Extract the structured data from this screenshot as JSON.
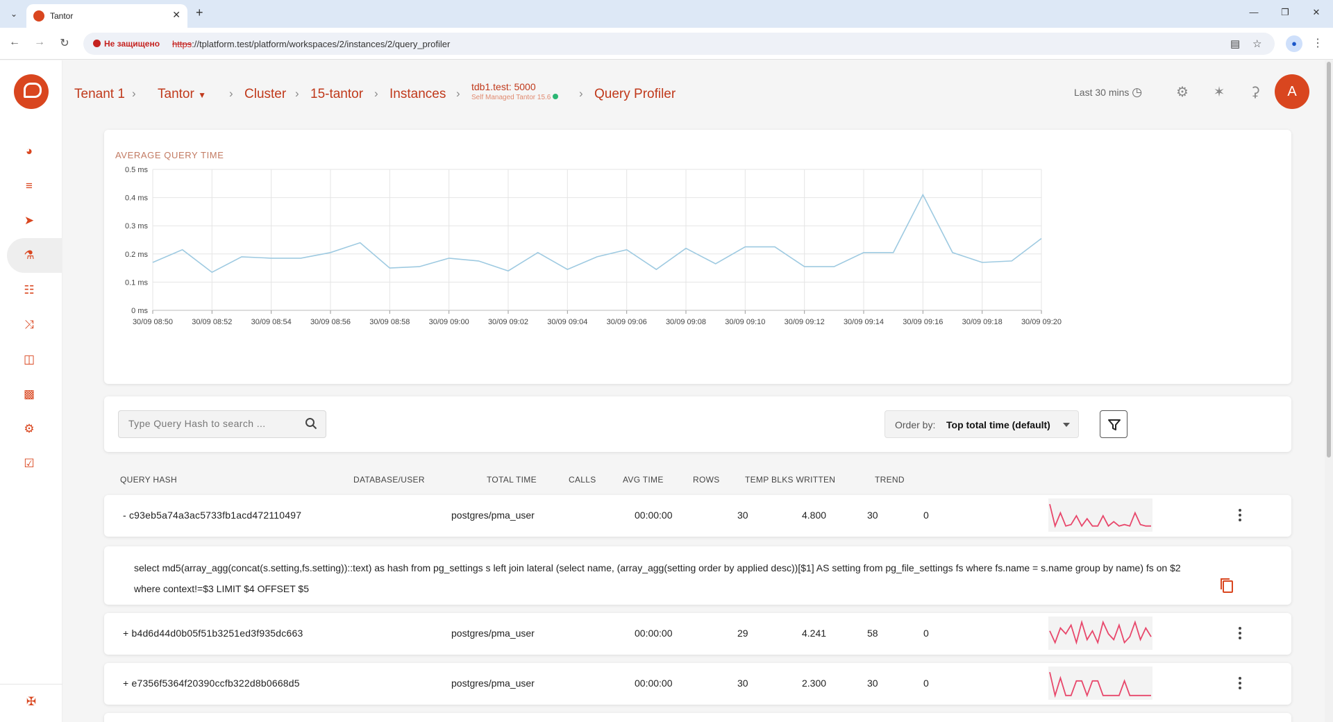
{
  "browser": {
    "tab_title": "Tantor",
    "insecure_label": "Не защищено",
    "url_scheme": "https",
    "url_rest": "://tplatform.test/platform/workspaces/2/instances/2/query_profiler",
    "profile_initial": ""
  },
  "breadcrumb": {
    "tenant": "Tenant 1",
    "product": "Tantor",
    "cluster": "Cluster",
    "cluster_name": "15-tantor",
    "instances": "Instances",
    "instance_name": "tdb1.test: 5000",
    "instance_sub": "Self Managed Tantor 15.6",
    "current": "Query Profiler"
  },
  "header": {
    "time_range": "Last 30 mins",
    "avatar_initial": "A"
  },
  "chart_data": {
    "type": "line",
    "title": "AVERAGE QUERY TIME",
    "x": [
      "30/09 08:50",
      "30/09 08:51",
      "30/09 08:52",
      "30/09 08:53",
      "30/09 08:54",
      "30/09 08:55",
      "30/09 08:56",
      "30/09 08:57",
      "30/09 08:58",
      "30/09 08:59",
      "30/09 09:00",
      "30/09 09:01",
      "30/09 09:02",
      "30/09 09:03",
      "30/09 09:04",
      "30/09 09:05",
      "30/09 09:06",
      "30/09 09:07",
      "30/09 09:08",
      "30/09 09:09",
      "30/09 09:10",
      "30/09 09:11",
      "30/09 09:12",
      "30/09 09:13",
      "30/09 09:14",
      "30/09 09:15",
      "30/09 09:16",
      "30/09 09:17",
      "30/09 09:18",
      "30/09 09:19",
      "30/09 09:20"
    ],
    "x_tick_labels": [
      "30/09 08:50",
      "30/09 08:52",
      "30/09 08:54",
      "30/09 08:56",
      "30/09 08:58",
      "30/09 09:00",
      "30/09 09:02",
      "30/09 09:04",
      "30/09 09:06",
      "30/09 09:08",
      "30/09 09:10",
      "30/09 09:12",
      "30/09 09:14",
      "30/09 09:16",
      "30/09 09:18",
      "30/09 09:20"
    ],
    "series": [
      {
        "values": [
          0.17,
          0.215,
          0.135,
          0.19,
          0.185,
          0.185,
          0.205,
          0.24,
          0.15,
          0.155,
          0.185,
          0.175,
          0.14,
          0.205,
          0.145,
          0.19,
          0.215,
          0.145,
          0.22,
          0.165,
          0.225,
          0.225,
          0.155,
          0.155,
          0.205,
          0.205,
          0.41,
          0.205,
          0.17,
          0.175,
          0.255
        ]
      }
    ],
    "y_ticks": [
      "0 ms",
      "0.1 ms",
      "0.2 ms",
      "0.3 ms",
      "0.4 ms",
      "0.5 ms"
    ],
    "ylim": [
      0,
      0.5
    ],
    "grid": true,
    "line_color": "#9ecae1"
  },
  "toolbar": {
    "search_placeholder": "Type Query Hash to search ...",
    "order_label": "Order by:",
    "order_value": "Top total time (default)"
  },
  "table": {
    "columns": [
      "QUERY HASH",
      "DATABASE/USER",
      "TOTAL TIME",
      "CALLS",
      "AVG TIME",
      "ROWS",
      "TEMP BLKS WRITTEN",
      "TREND"
    ],
    "rows": [
      {
        "hash": "- c93eb5a74a3ac5733fb1acd472110497",
        "db": "postgres/pma_user",
        "total": "00:00:00",
        "calls": "30",
        "avg": "4.800",
        "rows": "30",
        "temp": "0",
        "trend": [
          0.9,
          0.15,
          0.6,
          0.15,
          0.2,
          0.5,
          0.15,
          0.4,
          0.15,
          0.15,
          0.5,
          0.15,
          0.3,
          0.15,
          0.2,
          0.15,
          0.6,
          0.2,
          0.15,
          0.15
        ]
      },
      {
        "hash": "+ b4d6d44d0b05f51b3251ed3f935dc663",
        "db": "postgres/pma_user",
        "total": "00:00:00",
        "calls": "29",
        "avg": "4.241",
        "rows": "58",
        "temp": "0",
        "trend": [
          0.6,
          0.2,
          0.7,
          0.5,
          0.8,
          0.2,
          0.9,
          0.3,
          0.6,
          0.2,
          0.9,
          0.5,
          0.3,
          0.8,
          0.2,
          0.4,
          0.9,
          0.3,
          0.7,
          0.4
        ]
      },
      {
        "hash": "+ e7356f5364f20390ccfb322d8b0668d5",
        "db": "postgres/pma_user",
        "total": "00:00:00",
        "calls": "30",
        "avg": "2.300",
        "rows": "30",
        "temp": "0",
        "trend": [
          0.9,
          0.1,
          0.7,
          0.1,
          0.1,
          0.6,
          0.6,
          0.1,
          0.6,
          0.6,
          0.1,
          0.1,
          0.1,
          0.1,
          0.6,
          0.1,
          0.1,
          0.1,
          0.1,
          0.1
        ]
      }
    ],
    "trend_color": "#e8476b",
    "expanded_query": "select md5(array_agg(concat(s.setting,fs.setting))::text) as hash from pg_settings s left join lateral (select name, (array_agg(setting order by applied desc))[$1] AS setting from pg_file_settings fs where fs.name = s.name group by name) fs on $2 where context!=$3 LIMIT $4 OFFSET $5"
  }
}
